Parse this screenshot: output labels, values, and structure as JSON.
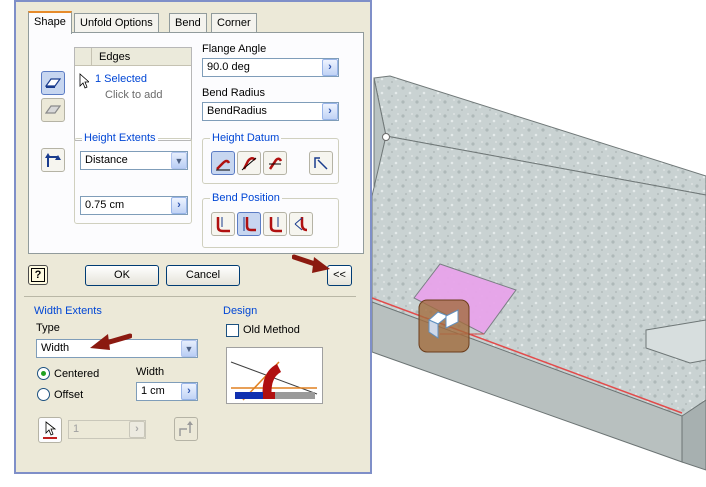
{
  "tabs": [
    "Shape",
    "Unfold Options",
    "Bend",
    "Corner"
  ],
  "edges": {
    "header": "Edges",
    "selected": "1 Selected",
    "click_to_add": "Click to add"
  },
  "flange_angle": {
    "label": "Flange Angle",
    "value": "90.0 deg"
  },
  "bend_radius": {
    "label": "Bend Radius",
    "value": "BendRadius"
  },
  "height_extents": {
    "label": "Height Extents",
    "type_value": "Distance",
    "distance_value": "0.75 cm"
  },
  "height_datum": {
    "label": "Height Datum"
  },
  "bend_position": {
    "label": "Bend Position"
  },
  "buttons": {
    "ok": "OK",
    "cancel": "Cancel",
    "collapse": "<<",
    "help": "?"
  },
  "width_extents": {
    "label": "Width Extents",
    "type_label": "Type",
    "type_value": "Width",
    "centered": "Centered",
    "offset": "Offset",
    "width_label": "Width",
    "width_value": "1 cm",
    "count_value": "1"
  },
  "design": {
    "label": "Design",
    "old_method": "Old Method"
  },
  "colors": {
    "accent": "#0046d5",
    "dialog_bg": "#ece9d8",
    "tab_highlight": "#e68b2c",
    "annotation_arrow": "#8b1a10",
    "face_highlight": "#e8a3ea"
  }
}
